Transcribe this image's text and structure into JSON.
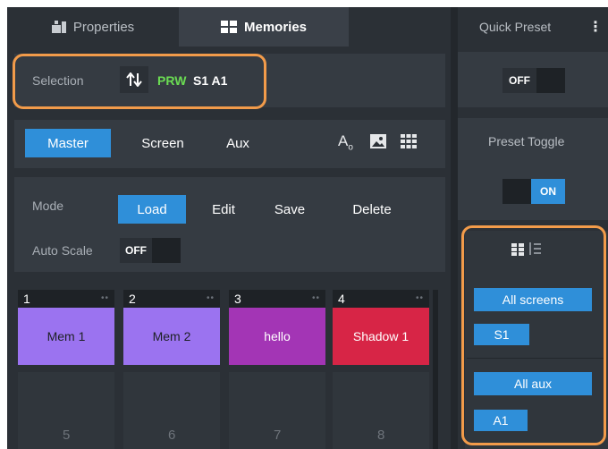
{
  "tabs": [
    {
      "label": "Properties",
      "icon": "properties-icon",
      "active": false
    },
    {
      "label": "Memories",
      "icon": "grid-icon",
      "active": true
    }
  ],
  "right_header": {
    "title": "Quick Preset",
    "menu_icon": "vertical-dots-icon"
  },
  "selection": {
    "label": "Selection",
    "icon": "swap-arrows-icon",
    "prw": "PRW",
    "value": "S1 A1"
  },
  "scope_tabs": [
    "Master",
    "Screen",
    "Aux"
  ],
  "scope_active": "Master",
  "tool_icons": [
    "text-size-icon",
    "image-icon",
    "grid-icon"
  ],
  "mode": {
    "label": "Mode",
    "options": [
      "Load",
      "Edit",
      "Save",
      "Delete"
    ],
    "active": "Load"
  },
  "auto_scale": {
    "label": "Auto Scale",
    "state": "OFF"
  },
  "memories": [
    {
      "number": "1",
      "name": "Mem 1",
      "color": "#9b73f0"
    },
    {
      "number": "2",
      "name": "Mem 2",
      "color": "#9b73f0"
    },
    {
      "number": "3",
      "name": "hello",
      "color": "#a335b5"
    },
    {
      "number": "4",
      "name": "Shadow 1",
      "color": "#d72546"
    }
  ],
  "empty_slots": [
    "5",
    "6",
    "7",
    "8"
  ],
  "quick_preset": {
    "state": "OFF"
  },
  "preset_toggle": {
    "label": "Preset Toggle",
    "state": "ON"
  },
  "filter_icons": [
    "grid-view-icon",
    "sort-list-icon"
  ],
  "screens": {
    "all_label": "All screens",
    "items": [
      "S1"
    ]
  },
  "aux": {
    "all_label": "All aux",
    "items": [
      "A1"
    ]
  },
  "colors": {
    "accent": "#2f8fd9",
    "highlight": "#f29b4a",
    "prw_green": "#6bdc53"
  }
}
